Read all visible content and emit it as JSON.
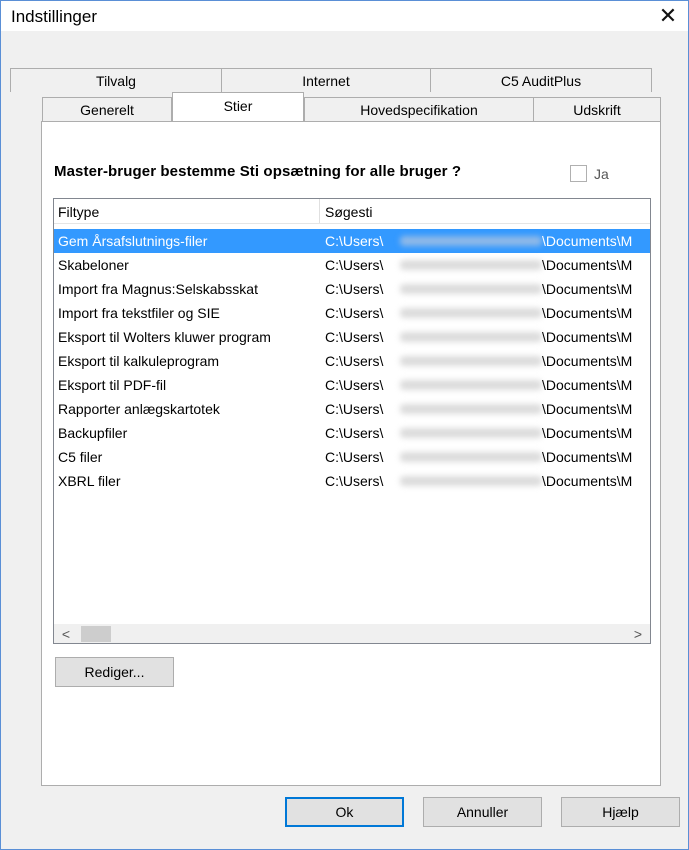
{
  "window": {
    "title": "Indstillinger",
    "close_glyph": "✕"
  },
  "tabs": {
    "back_row": [
      {
        "label": "Tilvalg"
      },
      {
        "label": "Internet"
      },
      {
        "label": "C5 AuditPlus"
      }
    ],
    "front_row": [
      {
        "label": "Generelt"
      },
      {
        "label": "Stier",
        "active": true
      },
      {
        "label": "Hovedspecifikation"
      },
      {
        "label": "Udskrift"
      }
    ]
  },
  "question": {
    "text": "Master-bruger bestemme Sti opsætning for alle bruger ?",
    "checkbox_checked": false,
    "checkbox_label": "Ja"
  },
  "list": {
    "columns": [
      "Filtype",
      "Søgesti"
    ],
    "rows": [
      {
        "type": "Gem Årsafslutnings-filer",
        "path_start": "C:\\Users\\",
        "path_end": "\\Documents\\M",
        "selected": true
      },
      {
        "type": "Skabeloner",
        "path_start": "C:\\Users\\",
        "path_end": "\\Documents\\M"
      },
      {
        "type": "Import fra Magnus:Selskabsskat",
        "path_start": "C:\\Users\\",
        "path_end": "\\Documents\\M"
      },
      {
        "type": "Import fra tekstfiler og SIE",
        "path_start": "C:\\Users\\",
        "path_end": "\\Documents\\M"
      },
      {
        "type": "Eksport til Wolters kluwer program",
        "path_start": "C:\\Users\\",
        "path_end": "\\Documents\\M"
      },
      {
        "type": "Eksport til kalkuleprogram",
        "path_start": "C:\\Users\\",
        "path_end": "\\Documents\\M"
      },
      {
        "type": "Eksport til PDF-fil",
        "path_start": "C:\\Users\\",
        "path_end": "\\Documents\\M"
      },
      {
        "type": "Rapporter anlægskartotek",
        "path_start": "C:\\Users\\",
        "path_end": "\\Documents\\M"
      },
      {
        "type": "Backupfiler",
        "path_start": "C:\\Users\\",
        "path_end": "\\Documents\\M"
      },
      {
        "type": "C5 filer",
        "path_start": "C:\\Users\\",
        "path_end": "\\Documents\\M"
      },
      {
        "type": "XBRL filer",
        "path_start": "C:\\Users\\",
        "path_end": "\\Documents\\M"
      }
    ],
    "scroll_left": "<",
    "scroll_right": ">"
  },
  "buttons": {
    "edit": "Rediger...",
    "ok": "Ok",
    "cancel": "Annuller",
    "help": "Hjælp"
  },
  "colors": {
    "selection": "#3399ff",
    "accent": "#0078d7"
  }
}
